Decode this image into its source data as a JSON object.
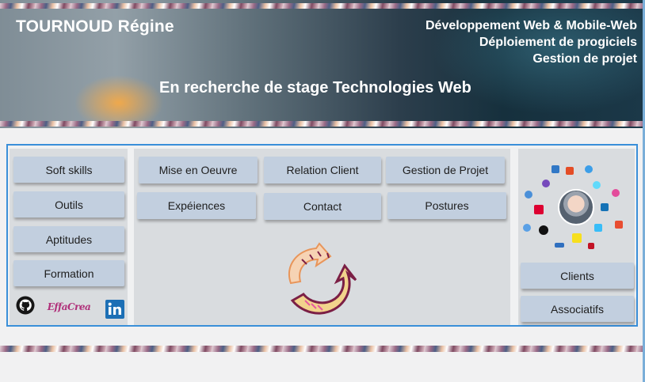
{
  "header": {
    "name": "TOURNOUD Régine",
    "skills": [
      "Développement Web & Mobile-Web",
      "Déploiement de progiciels",
      "Gestion de projet"
    ],
    "tagline": "En recherche de stage Technologies Web"
  },
  "left_menu": {
    "items": [
      "Soft skills",
      "Outils",
      "Aptitudes",
      "Formation"
    ]
  },
  "social": {
    "effacrea_label": "EffaCrea"
  },
  "main_menu": {
    "row1": [
      "Mise en Oeuvre",
      "Relation Client",
      "Gestion de Projet"
    ],
    "row2": [
      "Expéiences",
      "Contact",
      "Postures"
    ]
  },
  "right_menu": {
    "items": [
      "Clients",
      "Associatifs"
    ]
  },
  "colors": {
    "accent": "#3a8fd9",
    "button": "#c2cfdf",
    "arrow_orange": "#e8955a",
    "arrow_purple": "#7b1f45"
  },
  "icons": [
    "github-icon",
    "linkedin-icon",
    "refresh-arrows-icon"
  ]
}
